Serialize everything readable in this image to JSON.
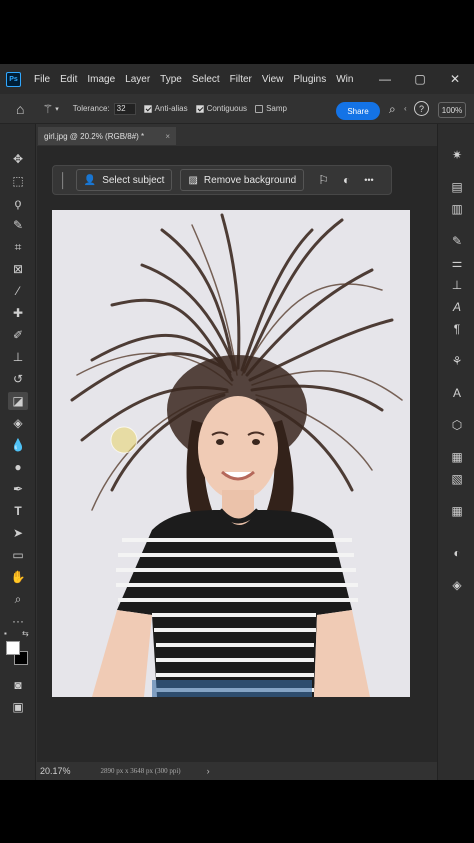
{
  "app": {
    "logo": "Ps",
    "menu": [
      "File",
      "Edit",
      "Image",
      "Layer",
      "Type",
      "Select",
      "Filter",
      "View",
      "Plugins",
      "Win"
    ],
    "window_controls": [
      "minimize-icon",
      "maximize-icon",
      "close-icon"
    ]
  },
  "options": {
    "tolerance_label": "Tolerance:",
    "tolerance_value": "32",
    "anti_alias_label": "Anti-alias",
    "contiguous_label": "Contiguous",
    "sample_label": "Samp",
    "share_label": "Share",
    "zoom_value": "100%"
  },
  "document": {
    "tab_title": "girl.jpg @ 20.2% (RGB/8#) *",
    "close": "×"
  },
  "taskbar": {
    "select_subject": "Select subject",
    "remove_background": "Remove background",
    "more": "•••"
  },
  "status": {
    "zoom": "20.17%",
    "dimensions": "2890 px x 3648 px (300 ppi)",
    "arrow": "›"
  }
}
